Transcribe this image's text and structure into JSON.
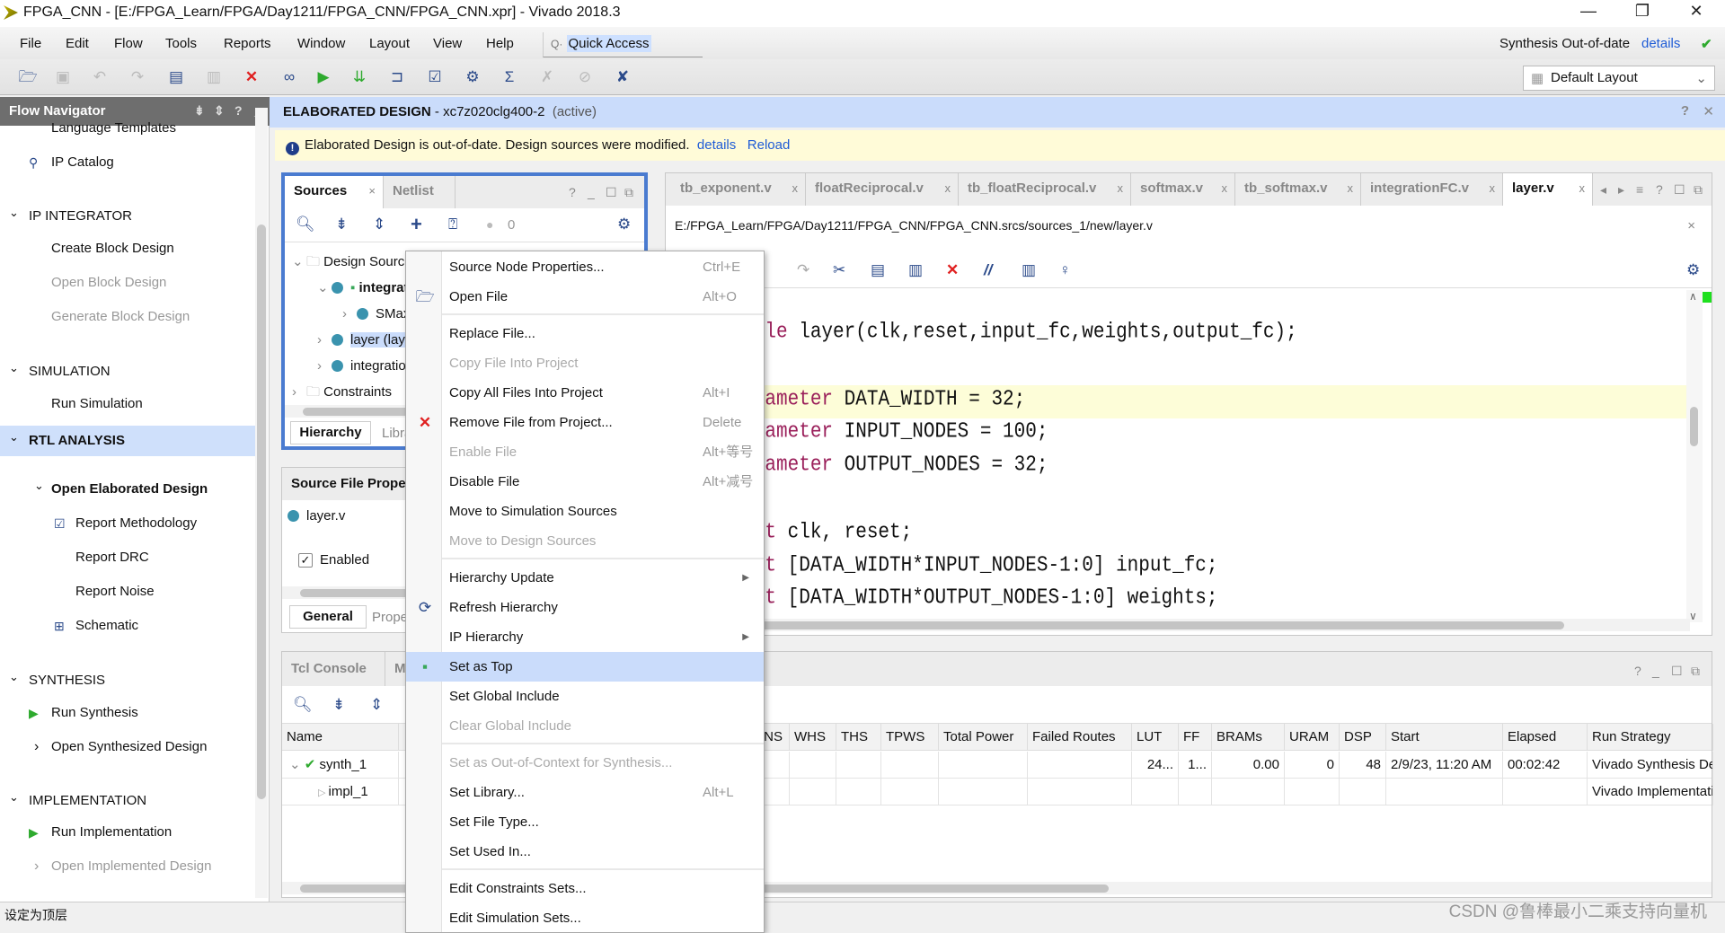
{
  "window": {
    "title": "FPGA_CNN - [E:/FPGA_Learn/FPGA/Day1211/FPGA_CNN/FPGA_CNN.xpr] - Vivado 2018.3",
    "minimize": "—",
    "restore": "❐",
    "close": "✕"
  },
  "menubar": {
    "items": [
      "File",
      "Edit",
      "Flow",
      "Tools",
      "Reports",
      "Window",
      "Layout",
      "View",
      "Help"
    ],
    "quick_access": "Quick Access"
  },
  "toolbar": {
    "icons": [
      "open-project-icon",
      "save-icon",
      "undo-icon",
      "redo-icon",
      "copy-icon",
      "paste-icon",
      "delete-icon",
      "find-icon",
      "run-icon",
      "run-bitstream-icon",
      "elaborate-icon",
      "report-icon",
      "settings-icon",
      "sigma-icon",
      "debug-icon",
      "disabled-icon",
      "cancel-icon"
    ]
  },
  "status": {
    "text": "Synthesis Out-of-date",
    "details": "details"
  },
  "layout": {
    "selected": "Default Layout"
  },
  "flow_navigator": {
    "title": "Flow Navigator",
    "items": [
      {
        "label": "Language Templates",
        "level": "sub",
        "state": "normal"
      },
      {
        "label": "IP Catalog",
        "level": "sub",
        "state": "normal",
        "icon": "ip-catalog-icon"
      },
      {
        "label": "IP INTEGRATOR",
        "level": "sec"
      },
      {
        "label": "Create Block Design",
        "level": "sub",
        "state": "normal"
      },
      {
        "label": "Open Block Design",
        "level": "sub",
        "state": "disabled"
      },
      {
        "label": "Generate Block Design",
        "level": "sub",
        "state": "disabled"
      },
      {
        "label": "SIMULATION",
        "level": "sec"
      },
      {
        "label": "Run Simulation",
        "level": "sub",
        "state": "normal"
      },
      {
        "label": "RTL ANALYSIS",
        "level": "sec",
        "state": "active"
      },
      {
        "label": "Open Elaborated Design",
        "level": "sub",
        "state": "bold"
      },
      {
        "label": "Report Methodology",
        "level": "sub2",
        "state": "normal",
        "icon": "clipboard-icon"
      },
      {
        "label": "Report DRC",
        "level": "sub2",
        "state": "normal"
      },
      {
        "label": "Report Noise",
        "level": "sub2",
        "state": "normal"
      },
      {
        "label": "Schematic",
        "level": "sub2",
        "state": "normal",
        "icon": "schematic-icon"
      },
      {
        "label": "SYNTHESIS",
        "level": "sec"
      },
      {
        "label": "Run Synthesis",
        "level": "sub",
        "state": "normal",
        "icon": "play-icon"
      },
      {
        "label": "Open Synthesized Design",
        "level": "sub",
        "state": "normal",
        "collapsed": true
      },
      {
        "label": "IMPLEMENTATION",
        "level": "sec"
      },
      {
        "label": "Run Implementation",
        "level": "sub",
        "state": "normal",
        "icon": "play-icon"
      },
      {
        "label": "Open Implemented Design",
        "level": "sub",
        "state": "disabled",
        "collapsed": true
      }
    ]
  },
  "design_header": {
    "title": "ELABORATED DESIGN",
    "part": " - xc7z020clg400-2",
    "status": "(active)"
  },
  "banner": {
    "message": "Elaborated Design is out-of-date. Design sources were modified.",
    "details": "details",
    "reload": "Reload"
  },
  "sources": {
    "tabs": [
      "Sources",
      "Netlist"
    ],
    "msg_count": "0",
    "tree": [
      {
        "label": "Design Sources",
        "indent": 0,
        "type": "folder",
        "expanded": true
      },
      {
        "label": "integrationFC",
        "indent": 1,
        "type": "top",
        "expanded": true
      },
      {
        "label": "SMax",
        "indent": 2,
        "type": "file"
      },
      {
        "label": "layer (layer.v)",
        "indent": 1,
        "type": "file",
        "selected": true
      },
      {
        "label": "integrationFC",
        "indent": 1,
        "type": "file"
      },
      {
        "label": "Constraints",
        "indent": 0,
        "type": "folder"
      }
    ],
    "bottom_tabs": [
      "Hierarchy",
      "Libraries"
    ]
  },
  "file_props": {
    "title": "Source File Properties",
    "file": "layer.v",
    "enabled_label": "Enabled",
    "enabled": true,
    "tabs": [
      "General",
      "Properties"
    ]
  },
  "editor": {
    "tabs": [
      "tb_exponent.v",
      "floatReciprocal.v",
      "tb_floatReciprocal.v",
      "softmax.v",
      "tb_softmax.v",
      "integrationFC.v",
      "layer.v"
    ],
    "active_tab": "layer.v",
    "path": "E:/FPGA_Learn/FPGA/Day1211/FPGA_CNN/FPGA_CNN.srcs/sources_1/new/layer.v",
    "lines": [
      {
        "kw": "module",
        "rest": " layer(clk,reset,input_fc,weights,output_fc);"
      },
      {
        "kw": " parameter",
        "rest": " DATA_WIDTH = 32;",
        "highlight": true
      },
      {
        "kw": " parameter",
        "rest": " INPUT_NODES = 100;"
      },
      {
        "kw": " parameter",
        "rest": " OUTPUT_NODES = 32;"
      },
      {
        "kw": "input",
        "rest": " clk, reset;"
      },
      {
        "kw": "input",
        "rest": " [DATA_WIDTH*INPUT_NODES-1:0] input_fc;"
      },
      {
        "kw": "input",
        "rest": " [DATA_WIDTH*OUTPUT_NODES-1:0] weights;"
      }
    ]
  },
  "context_menu": {
    "items": [
      {
        "label": "Source Node Properties...",
        "shortcut": "Ctrl+E"
      },
      {
        "label": "Open File",
        "shortcut": "Alt+O",
        "icon": "open-folder-icon"
      },
      {
        "sep": true
      },
      {
        "label": "Replace File..."
      },
      {
        "label": "Copy File Into Project",
        "disabled": true
      },
      {
        "label": "Copy All Files Into Project",
        "shortcut": "Alt+I"
      },
      {
        "label": "Remove File from Project...",
        "shortcut": "Delete",
        "icon": "remove-icon"
      },
      {
        "label": "Enable File",
        "shortcut": "Alt+等号",
        "disabled": true
      },
      {
        "label": "Disable File",
        "shortcut": "Alt+减号"
      },
      {
        "label": "Move to Simulation Sources"
      },
      {
        "label": "Move to Design Sources",
        "disabled": true
      },
      {
        "sep": true
      },
      {
        "label": "Hierarchy Update",
        "submenu": true
      },
      {
        "label": "Refresh Hierarchy",
        "icon": "refresh-icon"
      },
      {
        "label": "IP Hierarchy",
        "submenu": true
      },
      {
        "label": "Set as Top",
        "icon": "set-top-icon",
        "highlighted": true
      },
      {
        "label": "Set Global Include"
      },
      {
        "label": "Clear Global Include",
        "disabled": true
      },
      {
        "sep": true
      },
      {
        "label": "Set as Out-of-Context for Synthesis...",
        "disabled": true
      },
      {
        "label": "Set Library...",
        "shortcut": "Alt+L"
      },
      {
        "label": "Set File Type..."
      },
      {
        "label": "Set Used In..."
      },
      {
        "sep": true
      },
      {
        "label": "Edit Constraints Sets..."
      },
      {
        "label": "Edit Simulation Sets..."
      }
    ]
  },
  "console": {
    "tabs": [
      "Tcl Console",
      "Messages"
    ],
    "columns": [
      "Name",
      "TNS",
      "WHS",
      "THS",
      "TPWS",
      "Total Power",
      "Failed Routes",
      "LUT",
      "FF",
      "BRAMs",
      "URAM",
      "DSP",
      "Start",
      "Elapsed",
      "Run Strategy"
    ],
    "rows": [
      {
        "name": "synth_1",
        "status": "complete",
        "cells": [
          "",
          "",
          "",
          "",
          "",
          "",
          "",
          "24...",
          "1...",
          "0.00",
          "0",
          "48",
          "2/9/23, 11:20 AM",
          "00:02:42",
          "Vivado Synthesis Defaults"
        ]
      },
      {
        "name": "impl_1",
        "cells": [
          "",
          "",
          "",
          "",
          "",
          "",
          "",
          "",
          "",
          "",
          "",
          "",
          "",
          "",
          "Vivado Implementation Defaults"
        ]
      }
    ]
  },
  "statusbar": {
    "text": "设定为顶层"
  },
  "watermark": "CSDN @鲁棒最小二乘支持向量机",
  "colors": {
    "accent": "#cadcfb",
    "panel_border_active": "#4a7bd0",
    "banner": "#fffbd8",
    "link": "#1f5cd6",
    "keyword": "#9a1f5a",
    "run_green": "#2eaa2e",
    "error_red": "#e02020"
  }
}
